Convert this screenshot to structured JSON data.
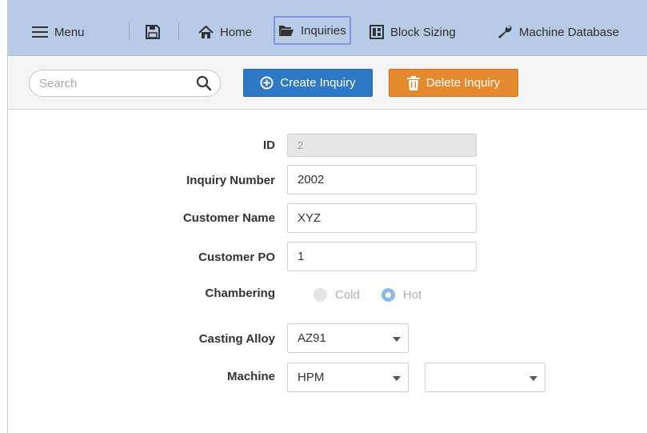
{
  "nav": {
    "menu_label": "Menu",
    "home_label": "Home",
    "inquiries_label": "Inquiries",
    "block_sizing_label": "Block Sizing",
    "machine_database_label": "Machine Database"
  },
  "toolbar": {
    "search_placeholder": "Search",
    "search_value": "",
    "create_label": "Create Inquiry",
    "delete_label": "Delete Inquiry"
  },
  "form": {
    "id": {
      "label": "ID",
      "value": "2"
    },
    "inquiry_number": {
      "label": "Inquiry Number",
      "value": "2002"
    },
    "customer_name": {
      "label": "Customer Name",
      "value": "XYZ"
    },
    "customer_po": {
      "label": "Customer PO",
      "value": "1"
    },
    "chambering": {
      "label": "Chambering",
      "options": [
        "Cold",
        "Hot"
      ],
      "selected": "Hot"
    },
    "casting_alloy": {
      "label": "Casting Alloy",
      "value": "AZ91"
    },
    "machine": {
      "label": "Machine",
      "value": "HPM",
      "model_value": ""
    }
  },
  "colors": {
    "topbar": "#b7cbe6",
    "create_button": "#2f78c5",
    "delete_button": "#e48a2c",
    "active_nav_outline": "#7f92e3"
  },
  "icons": {
    "menu": "hamburger-icon",
    "save": "save-icon",
    "home": "home-icon",
    "inquiries": "folder-open-icon",
    "block_sizing": "layout-icon",
    "machine_database": "wrench-icon",
    "search": "search-icon",
    "create": "plus-circle-icon",
    "delete": "trash-icon"
  }
}
